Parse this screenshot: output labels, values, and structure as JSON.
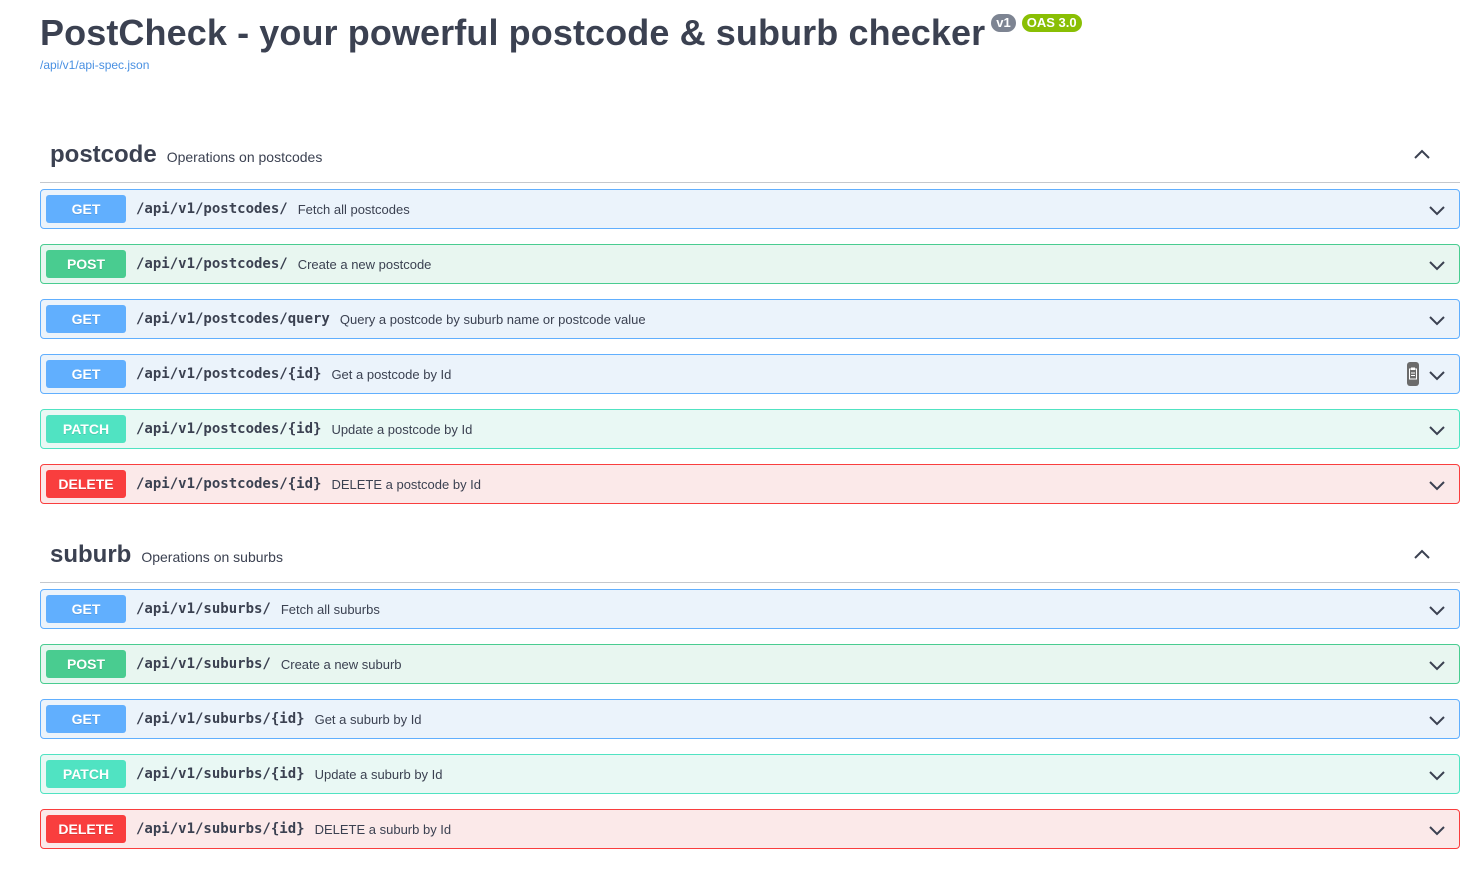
{
  "header": {
    "title": "PostCheck - your powerful postcode & suburb checker",
    "version_badge": "v1",
    "oas_badge": "OAS 3.0",
    "spec_link": "/api/v1/api-spec.json"
  },
  "sections": [
    {
      "name": "postcode",
      "description": "Operations on postcodes",
      "operations": [
        {
          "method": "GET",
          "path": "/api/v1/postcodes/",
          "summary": "Fetch all postcodes"
        },
        {
          "method": "POST",
          "path": "/api/v1/postcodes/",
          "summary": "Create a new postcode"
        },
        {
          "method": "GET",
          "path": "/api/v1/postcodes/query",
          "summary": "Query a postcode by suburb name or postcode value"
        },
        {
          "method": "GET",
          "path": "/api/v1/postcodes/{id}",
          "summary": "Get a postcode by Id"
        },
        {
          "method": "PATCH",
          "path": "/api/v1/postcodes/{id}",
          "summary": "Update a postcode by Id"
        },
        {
          "method": "DELETE",
          "path": "/api/v1/postcodes/{id}",
          "summary": "DELETE a postcode by Id"
        }
      ]
    },
    {
      "name": "suburb",
      "description": "Operations on suburbs",
      "operations": [
        {
          "method": "GET",
          "path": "/api/v1/suburbs/",
          "summary": "Fetch all suburbs"
        },
        {
          "method": "POST",
          "path": "/api/v1/suburbs/",
          "summary": "Create a new suburb"
        },
        {
          "method": "GET",
          "path": "/api/v1/suburbs/{id}",
          "summary": "Get a suburb by Id"
        },
        {
          "method": "PATCH",
          "path": "/api/v1/suburbs/{id}",
          "summary": "Update a suburb by Id"
        },
        {
          "method": "DELETE",
          "path": "/api/v1/suburbs/{id}",
          "summary": "DELETE a suburb by Id"
        }
      ]
    }
  ],
  "colors": {
    "get": "#61affe",
    "post": "#49cc90",
    "patch": "#50e3c2",
    "delete": "#f93e3e",
    "text": "#3b4151",
    "link": "#4990e2"
  },
  "icons": {
    "collapse": "chevron-up-icon",
    "expand": "chevron-down-icon",
    "copy": "copy-to-clipboard-icon"
  }
}
